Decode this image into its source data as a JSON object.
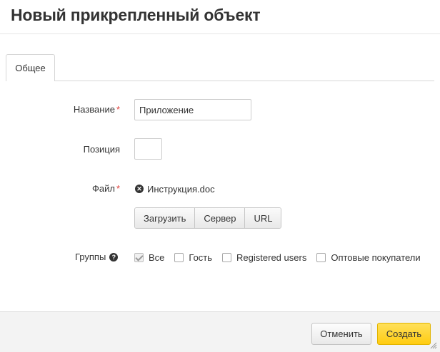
{
  "dialog": {
    "title": "Новый прикрепленный объект"
  },
  "tabs": [
    {
      "label": "Общее",
      "active": true
    }
  ],
  "form": {
    "name": {
      "label": "Название",
      "required": true,
      "value": "Приложение"
    },
    "position": {
      "label": "Позиция",
      "value": ""
    },
    "file": {
      "label": "Файл",
      "required": true,
      "filename": "Инструкция.doc",
      "buttons": [
        "Загрузить",
        "Сервер",
        "URL"
      ]
    },
    "groups": {
      "label": "Группы",
      "options": [
        {
          "label": "Все",
          "checked": true,
          "disabled": true
        },
        {
          "label": "Гость",
          "checked": false
        },
        {
          "label": "Registered users",
          "checked": false
        },
        {
          "label": "Оптовые покупатели",
          "checked": false
        }
      ]
    }
  },
  "footer": {
    "cancel_label": "Отменить",
    "create_label": "Создать"
  },
  "colors": {
    "primary_button": "#ffcc11",
    "required_star": "#e0403c"
  }
}
